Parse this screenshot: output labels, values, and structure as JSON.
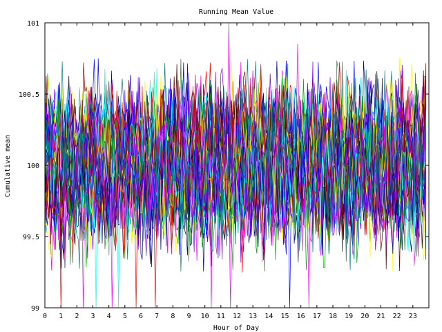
{
  "chart_data": {
    "type": "line",
    "title": "Running Mean Value",
    "xlabel": "Hour of Day",
    "ylabel": "Cumulative mean",
    "xlim": [
      0,
      24
    ],
    "ylim": [
      99,
      101
    ],
    "x_ticks": [
      0,
      1,
      2,
      3,
      4,
      5,
      6,
      7,
      8,
      9,
      10,
      11,
      12,
      13,
      14,
      15,
      16,
      17,
      18,
      19,
      20,
      21,
      22,
      23
    ],
    "x_tick_labels": [
      "0",
      "1",
      "2",
      "3",
      "4",
      "5",
      "6",
      "7",
      "8",
      "9",
      "10",
      "11",
      "12",
      "13",
      "14",
      "15",
      "16",
      "17",
      "18",
      "19",
      "20",
      "21",
      "22",
      "23"
    ],
    "y_ticks": [
      99,
      99.5,
      100,
      100.5,
      101
    ],
    "y_tick_labels": [
      "99",
      "99.5",
      "100",
      "100.5",
      "101"
    ],
    "grid": false,
    "legend": "none",
    "series_colors": [
      "#ff0000",
      "#00aa00",
      "#0000ff",
      "#ff00ff",
      "#00ffff",
      "#ffff00",
      "#800000",
      "#000080",
      "#8000ff",
      "#008080"
    ],
    "series_count": 50,
    "samples_per_hour": 12,
    "center_value": 100,
    "typical_spread": 0.22,
    "spikes": [
      {
        "color": "#ff0000",
        "x": 1.0,
        "y": 99
      },
      {
        "color": "#ff00ff",
        "x": 2.4,
        "y": 99
      },
      {
        "color": "#00ffff",
        "x": 3.2,
        "y": 99
      },
      {
        "color": "#ff00ff",
        "x": 4.2,
        "y": 99
      },
      {
        "color": "#00ffff",
        "x": 4.6,
        "y": 99
      },
      {
        "color": "#ff0000",
        "x": 5.7,
        "y": 99
      },
      {
        "color": "#ff0000",
        "x": 6.9,
        "y": 99
      },
      {
        "color": "#ff00ff",
        "x": 10.4,
        "y": 99
      },
      {
        "color": "#ff00ff",
        "x": 11.5,
        "y": 101
      },
      {
        "color": "#ff00ff",
        "x": 11.6,
        "y": 99
      },
      {
        "color": "#0000ff",
        "x": 15.3,
        "y": 99
      },
      {
        "color": "#ff00ff",
        "x": 15.8,
        "y": 100.85
      },
      {
        "color": "#ff00ff",
        "x": 16.5,
        "y": 99
      }
    ]
  }
}
